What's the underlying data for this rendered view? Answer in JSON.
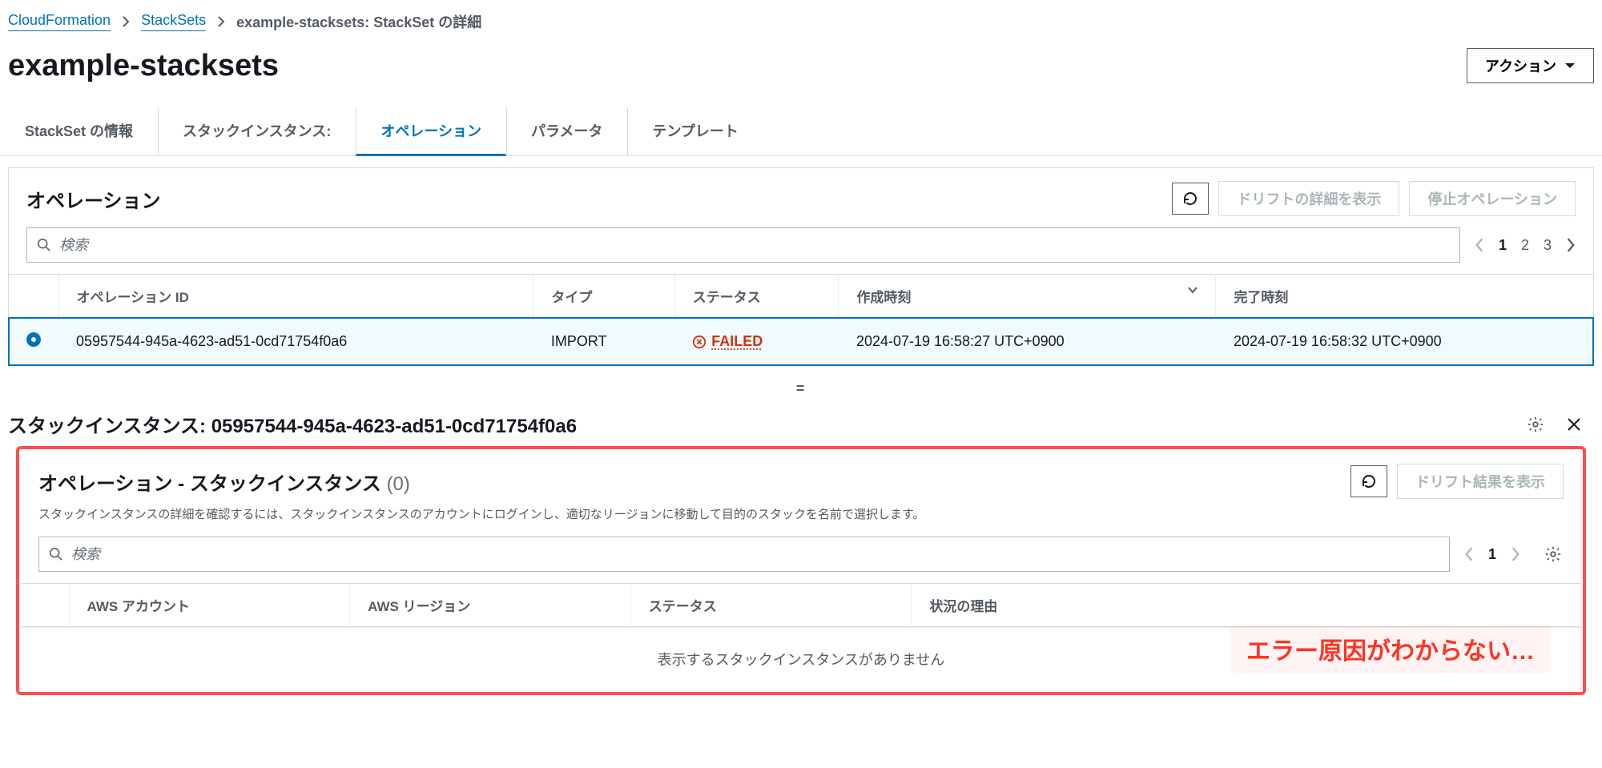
{
  "breadcrumb": {
    "root": "CloudFormation",
    "level2": "StackSets",
    "current": "example-stacksets: StackSet の詳細"
  },
  "header": {
    "title": "example-stacksets",
    "action_label": "アクション"
  },
  "tabs": [
    {
      "label": "StackSet の情報"
    },
    {
      "label": "スタックインスタンス:"
    },
    {
      "label": "オペレーション"
    },
    {
      "label": "パラメータ"
    },
    {
      "label": "テンプレート"
    }
  ],
  "operations_panel": {
    "title": "オペレーション",
    "drift_button": "ドリフトの詳細を表示",
    "stop_button": "停止オペレーション",
    "search_placeholder": "検索",
    "pages": [
      "1",
      "2",
      "3"
    ],
    "columns": {
      "op_id": "オペレーション ID",
      "type": "タイプ",
      "status": "ステータス",
      "created": "作成時刻",
      "completed": "完了時刻"
    },
    "row": {
      "op_id": "05957544-945a-4623-ad51-0cd71754f0a6",
      "type": "IMPORT",
      "status": "FAILED",
      "created": "2024-07-19 16:58:27 UTC+0900",
      "completed": "2024-07-19 16:58:32 UTC+0900"
    }
  },
  "detail": {
    "title": "スタックインスタンス: 05957544-945a-4623-ad51-0cd71754f0a6"
  },
  "op_instances_panel": {
    "title": "オペレーション - スタックインスタンス",
    "count": "(0)",
    "drift_button": "ドリフト結果を表示",
    "subtitle": "スタックインスタンスの詳細を確認するには、スタックインスタンスのアカウントにログインし、適切なリージョンに移動して目的のスタックを名前で選択します。",
    "search_placeholder": "検索",
    "page": "1",
    "columns": {
      "account": "AWS アカウント",
      "region": "AWS リージョン",
      "status": "ステータス",
      "reason": "状況の理由"
    },
    "empty": "表示するスタックインスタンスがありません"
  },
  "annotation": "エラー原因がわからない…"
}
